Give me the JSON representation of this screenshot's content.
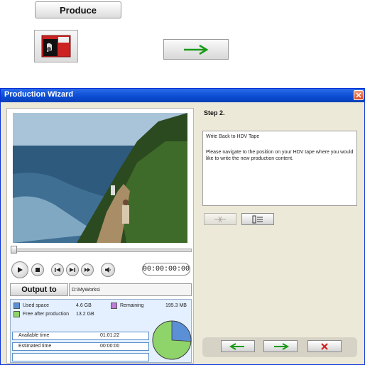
{
  "top": {
    "produce_label": "Produce"
  },
  "window": {
    "title": "Production Wizard",
    "close_glyph": "✕"
  },
  "player": {
    "timecode": "00:00:00:00",
    "controls": [
      "play",
      "stop",
      "previous-frame",
      "next-frame",
      "fast-forward",
      "volume"
    ]
  },
  "output": {
    "button_label": "Output to",
    "path": "D:\\MyWorks\\"
  },
  "disk": {
    "used_label": "Used space",
    "used_value": "4.6 GB",
    "used_color": "#5b8fd6",
    "remaining_label": "Remaining",
    "remaining_value": "195.3 MB",
    "remaining_color": "#c07ad8",
    "free_label": "Free after production",
    "free_value": "13.2 GB",
    "free_color": "#8fd46a",
    "pie_used_fraction": 0.26
  },
  "times": {
    "available_label": "Available time",
    "available_value": "01:01:22",
    "estimated_label": "Estimated time",
    "estimated_value": "00:00:00"
  },
  "wizard": {
    "step": "Step 2.",
    "desc_title": "Write Back to HDV Tape",
    "desc_body": "Please navigate to the position on your HDV tape where you would like to write the new production content."
  },
  "colors": {
    "accent_green": "#1a9a1a",
    "cancel_red": "#d01a1a",
    "title_blue": "#0a4bd1"
  }
}
